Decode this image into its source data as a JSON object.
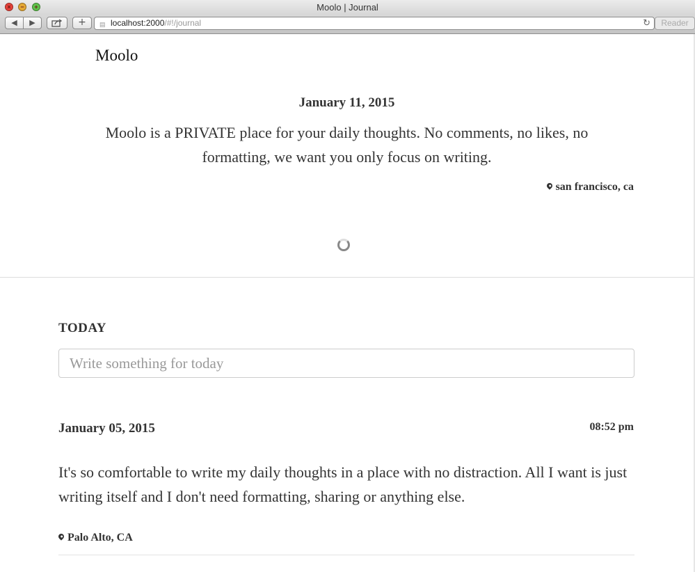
{
  "window": {
    "title": "Moolo | Journal"
  },
  "toolbar": {
    "url_host": "localhost:2000",
    "url_path": "/#!/journal",
    "add_label": "+",
    "reader_label": "Reader"
  },
  "app": {
    "brand": "Moolo"
  },
  "featured": {
    "date": "January 11, 2015",
    "text": "Moolo is a PRIVATE place for your daily thoughts. No comments, no likes, no formatting, we want you only focus on writing.",
    "location": "san francisco, ca"
  },
  "today": {
    "label": "TODAY",
    "placeholder": "Write something for today"
  },
  "entries": [
    {
      "date": "January 05, 2015",
      "time": "08:52 pm",
      "text": "It's so comfortable to write my daily thoughts in a place with no distraction. All I want is just writing itself and I don't need formatting, sharing or anything else.",
      "location": "Palo Alto, CA"
    }
  ]
}
